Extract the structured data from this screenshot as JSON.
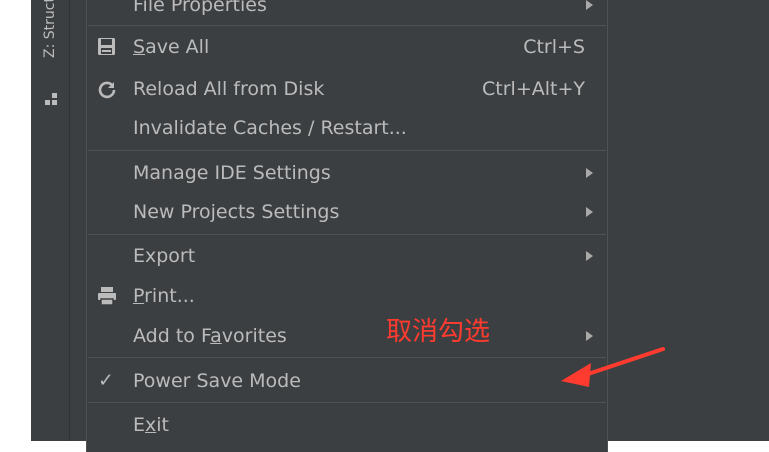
{
  "side_panel": {
    "tab_label": "Z: Struct"
  },
  "menu": {
    "items": [
      {
        "label": "File Properties",
        "submenu": true,
        "icon": null
      },
      {
        "label_pre": "",
        "mnemonic": "S",
        "label_post": "ave All",
        "shortcut": "Ctrl+S",
        "icon": "save-icon"
      },
      {
        "label": "Reload All from Disk",
        "shortcut": "Ctrl+Alt+Y",
        "icon": "reload-icon"
      },
      {
        "label": "Invalidate Caches / Restart..."
      },
      {
        "label": "Manage IDE Settings",
        "submenu": true
      },
      {
        "label": "New Projects Settings",
        "submenu": true
      },
      {
        "label": "Export",
        "submenu": true
      },
      {
        "label_pre": "",
        "mnemonic": "P",
        "label_post": "rint...",
        "icon": "print-icon"
      },
      {
        "label_pre": "Add to F",
        "mnemonic": "a",
        "label_post": "vorites",
        "submenu": true
      },
      {
        "label": "Power Save Mode",
        "checked": true
      },
      {
        "label_pre": "E",
        "mnemonic": "x",
        "label_post": "it"
      }
    ]
  },
  "annotation": {
    "text": "取消勾选",
    "color": "#ff3b30"
  },
  "colors": {
    "menu_bg": "#3c3f41",
    "menu_text": "#bbbbbb",
    "separator": "#515151",
    "accent_red": "#ff3b30"
  }
}
